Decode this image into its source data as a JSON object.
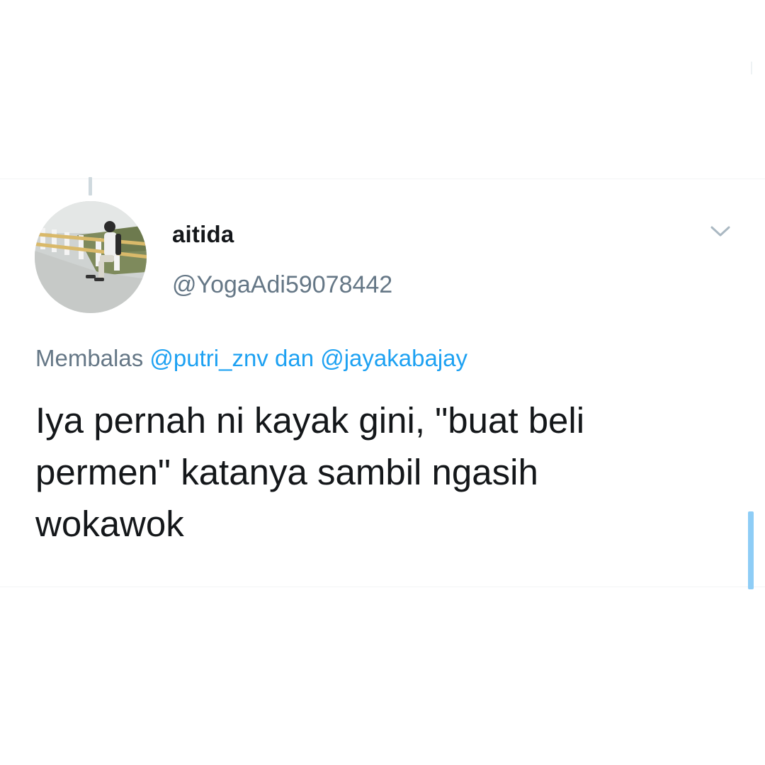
{
  "tweet": {
    "display_name": "aitida",
    "handle": "@YogaAdi59078442",
    "reply_prefix": "Membalas",
    "reply_mention_1": "@putri_znv",
    "reply_joiner": "dan",
    "reply_mention_2": "@jayakabajay",
    "text_line_1": "Iya pernah ni kayak gini, \"buat beli",
    "text_line_2": "permen\" katanya sambil ngasih",
    "text_line_3": "wokawok"
  },
  "icons": {
    "menu": "chevron-down-icon",
    "avatar": "avatar"
  },
  "colors": {
    "text_primary": "#14171a",
    "text_secondary": "#657786",
    "link": "#1da1f2",
    "thread_line": "#cfd9de",
    "scroll_indicator": "#8ecdf6"
  }
}
